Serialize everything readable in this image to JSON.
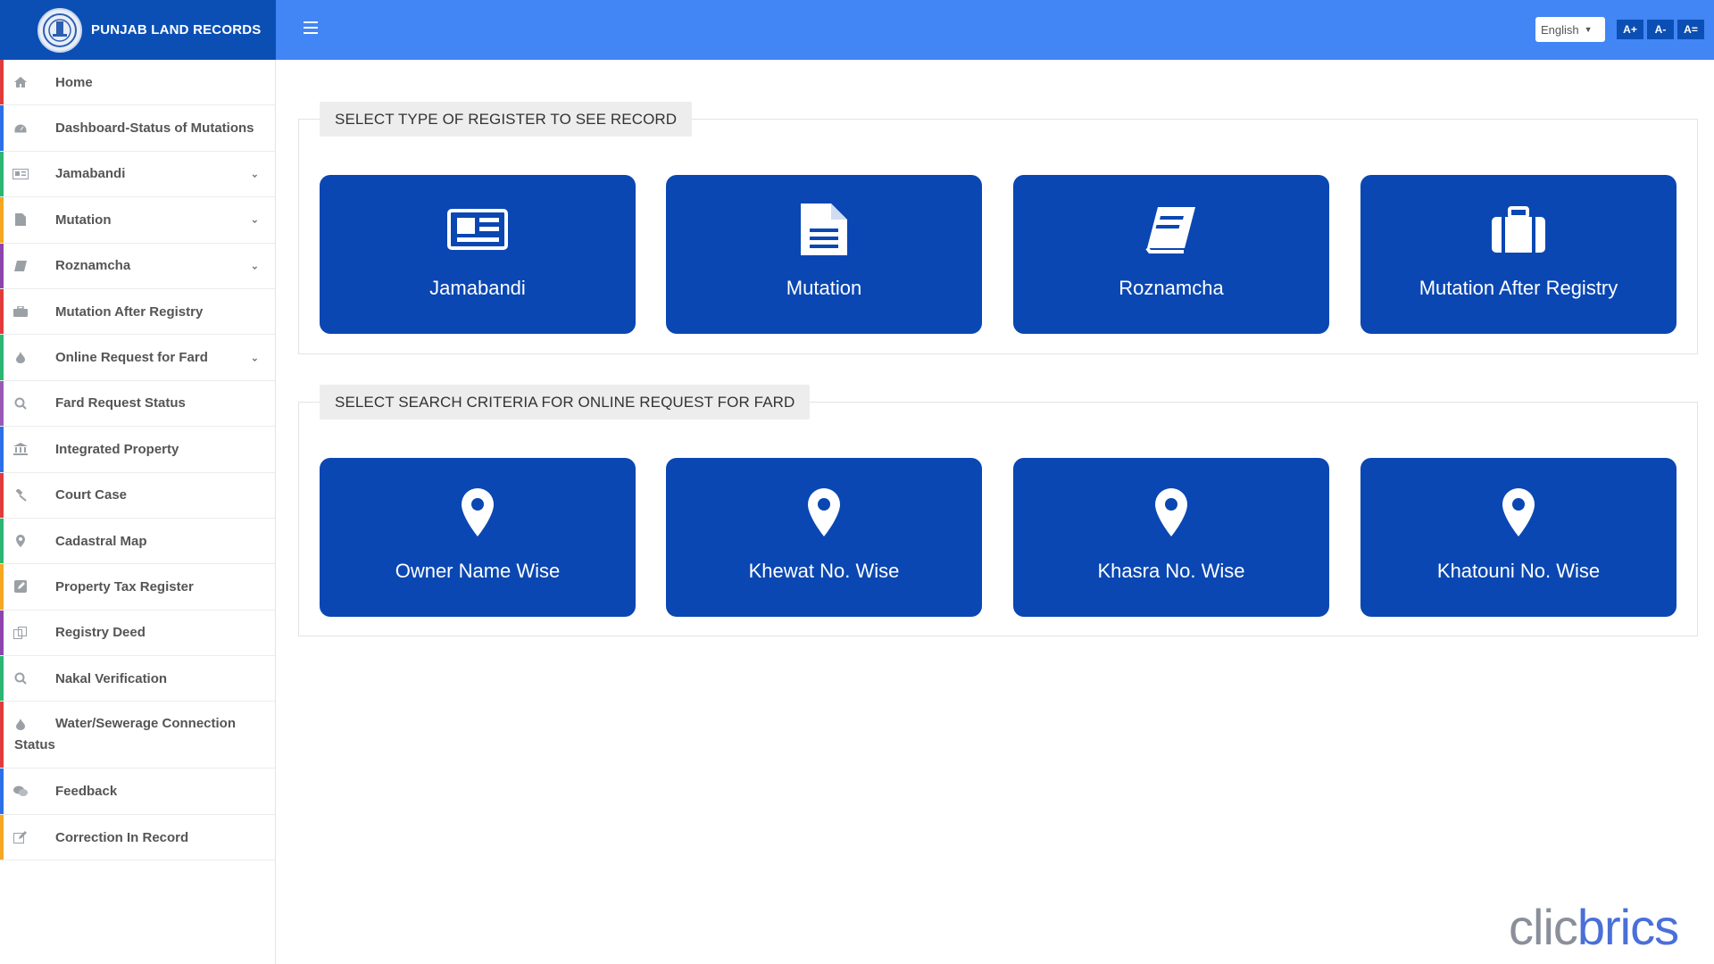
{
  "header": {
    "title": "PUNJAB LAND RECORDS",
    "language": "English",
    "font_buttons": [
      "A+",
      "A-",
      "A="
    ]
  },
  "sidebar": {
    "items": [
      {
        "label": "Home",
        "icon": "home-icon",
        "color": "#e23b3b",
        "caret": false
      },
      {
        "label": "Dashboard-Status of Mutations",
        "icon": "dashboard-icon",
        "color": "#2d6fe6",
        "caret": false
      },
      {
        "label": "Jamabandi",
        "icon": "newspaper-icon",
        "color": "#2bb673",
        "caret": true
      },
      {
        "label": "Mutation",
        "icon": "file-icon",
        "color": "#f5a623",
        "caret": true
      },
      {
        "label": "Roznamcha",
        "icon": "book-icon",
        "color": "#8e44ad",
        "caret": true
      },
      {
        "label": "Mutation After Registry",
        "icon": "briefcase-icon",
        "color": "#e23b3b",
        "caret": false
      },
      {
        "label": "Online Request for Fard",
        "icon": "fire-icon",
        "color": "#2bb673",
        "caret": true
      },
      {
        "label": "Fard Request Status",
        "icon": "search-icon",
        "color": "#9b59b6",
        "caret": false
      },
      {
        "label": "Integrated Property",
        "icon": "bank-icon",
        "color": "#2d6fe6",
        "caret": false
      },
      {
        "label": "Court Case",
        "icon": "gavel-icon",
        "color": "#e23b3b",
        "caret": false
      },
      {
        "label": "Cadastral Map",
        "icon": "map-marker-icon",
        "color": "#2bb673",
        "caret": false
      },
      {
        "label": "Property Tax Register",
        "icon": "edit-icon",
        "color": "#f5a623",
        "caret": false
      },
      {
        "label": "Registry Deed",
        "icon": "copy-icon",
        "color": "#8e44ad",
        "caret": false
      },
      {
        "label": "Nakal Verification",
        "icon": "search-icon",
        "color": "#2bb673",
        "caret": false
      },
      {
        "label_line1": "Water/Sewerage Connection",
        "label_line2": "Status",
        "icon": "fire-icon",
        "color": "#e23b3b",
        "caret": false
      },
      {
        "label": "Feedback",
        "icon": "comments-icon",
        "color": "#2d6fe6",
        "caret": false
      },
      {
        "label": "Correction In Record",
        "icon": "pencil-square-icon",
        "color": "#f5a623",
        "caret": false
      }
    ]
  },
  "register_section": {
    "title": "SELECT TYPE OF REGISTER TO SEE RECORD",
    "cards": [
      {
        "label": "Jamabandi",
        "icon": "newspaper-icon"
      },
      {
        "label": "Mutation",
        "icon": "file-text-icon"
      },
      {
        "label": "Roznamcha",
        "icon": "book-icon"
      },
      {
        "label": "Mutation After Registry",
        "icon": "briefcase-icon"
      }
    ]
  },
  "search_section": {
    "title": "SELECT SEARCH CRITERIA FOR ONLINE REQUEST FOR FARD",
    "cards": [
      {
        "label": "Owner Name Wise",
        "icon": "map-marker-icon"
      },
      {
        "label": "Khewat No. Wise",
        "icon": "map-marker-icon"
      },
      {
        "label": "Khasra No. Wise",
        "icon": "map-marker-icon"
      },
      {
        "label": "Khatouni No. Wise",
        "icon": "map-marker-icon"
      }
    ]
  },
  "watermark": {
    "part1": "clic",
    "part2": "brics"
  },
  "colors": {
    "brand": "#0b4fb5",
    "topbar": "#4285f4",
    "card": "#0a47b2"
  }
}
